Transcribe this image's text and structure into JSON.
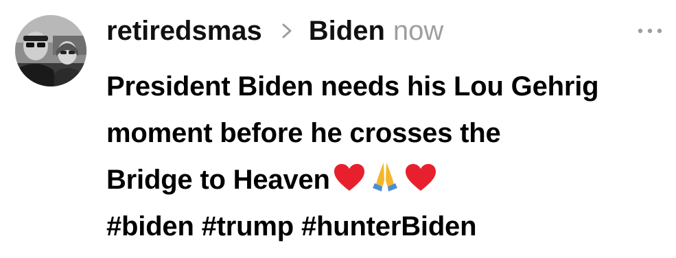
{
  "post": {
    "author": "retiredsmas",
    "group": "Biden",
    "time": "now",
    "text_lines": [
      "President Biden needs his Lou Gehrig",
      "moment before he crosses the",
      "Bridge to Heaven"
    ],
    "emojis": [
      "red-heart",
      "folded-hands",
      "red-heart"
    ],
    "hashtags": [
      "#biden",
      "#trump",
      "#hunterBiden"
    ]
  },
  "icons": {
    "chevron": "chevron-right-icon",
    "more": "more-horizontal-icon"
  },
  "colors": {
    "text": "#111111",
    "time": "#9e9e9e",
    "more": "#9e9e9e",
    "heart": "#e8202e",
    "hands": "#f6b629"
  }
}
